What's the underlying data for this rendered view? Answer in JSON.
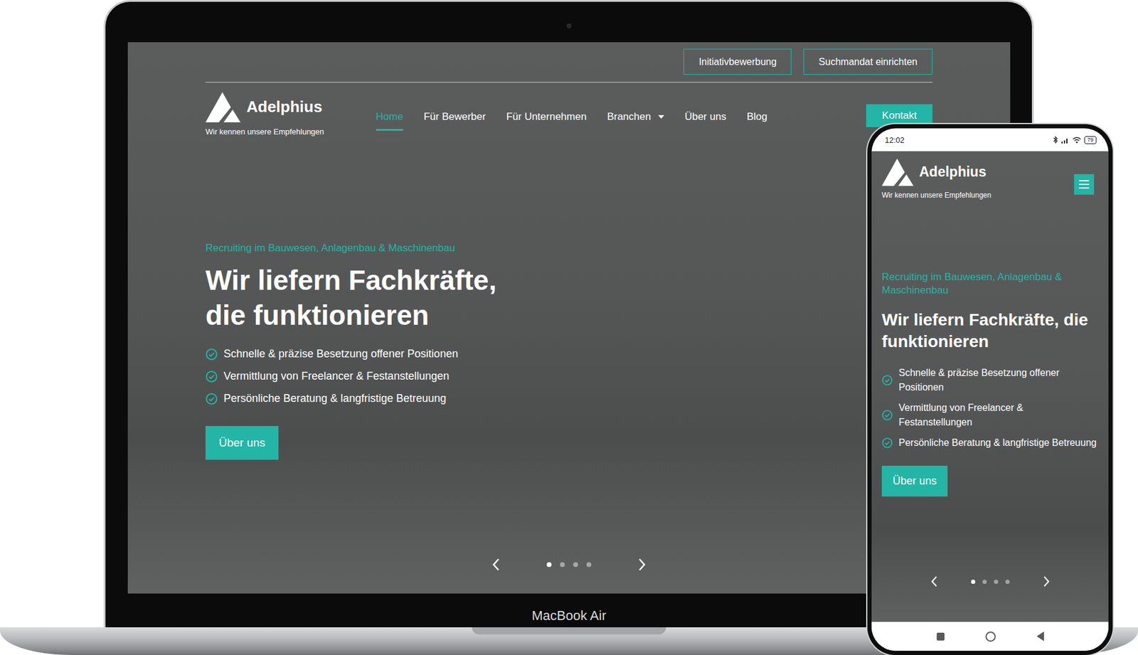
{
  "device": {
    "label": "MacBook Air"
  },
  "site": {
    "top_buttons": [
      "Initiativbewerbung",
      "Suchmandat einrichten"
    ],
    "logo": {
      "name": "Adelphius",
      "tagline": "Wir kennen unsere Empfehlungen"
    },
    "nav": [
      {
        "label": "Home",
        "selected": true,
        "dropdown": false
      },
      {
        "label": "Für Bewerber",
        "selected": false,
        "dropdown": false
      },
      {
        "label": "Für Unternehmen",
        "selected": false,
        "dropdown": false
      },
      {
        "label": "Branchen",
        "selected": false,
        "dropdown": true
      },
      {
        "label": "Über uns",
        "selected": false,
        "dropdown": false
      },
      {
        "label": "Blog",
        "selected": false,
        "dropdown": false
      }
    ],
    "contact_button": "Kontakt",
    "hero": {
      "eyebrow": "Recruiting im Bauwesen, Anlagenbau & Maschinenbau",
      "title_lines": [
        "Wir liefern Fachkräfte,",
        "die funktionieren"
      ],
      "bullets": [
        "Schnelle & präzise Besetzung offener Positionen",
        "Vermittlung von Freelancer & Festanstellungen",
        "Persönliche Beratung & langfristige Betreuung"
      ],
      "button": "Über uns"
    },
    "slides": [
      {
        "selected": true
      },
      {
        "selected": false
      },
      {
        "selected": false
      },
      {
        "selected": false
      }
    ]
  },
  "phone": {
    "status_bar": {
      "time": "12:02",
      "battery": "79"
    },
    "logo": {
      "name": "Adelphius",
      "tagline": "Wir kennen unsere Empfehlungen"
    },
    "hero": {
      "eyebrow": "Recruiting im Bauwesen, Anlagenbau & Maschinenbau",
      "title": "Wir liefern Fachkräfte, die funktionieren",
      "bullets": [
        "Schnelle & präzise Besetzung offener Positionen",
        "Vermittlung von Freelancer & Festanstellungen",
        "Persönliche Beratung & langfristige Betreuung"
      ],
      "button": "Über uns"
    },
    "slides": [
      {
        "selected": true
      },
      {
        "selected": false
      },
      {
        "selected": false
      },
      {
        "selected": false
      }
    ]
  }
}
